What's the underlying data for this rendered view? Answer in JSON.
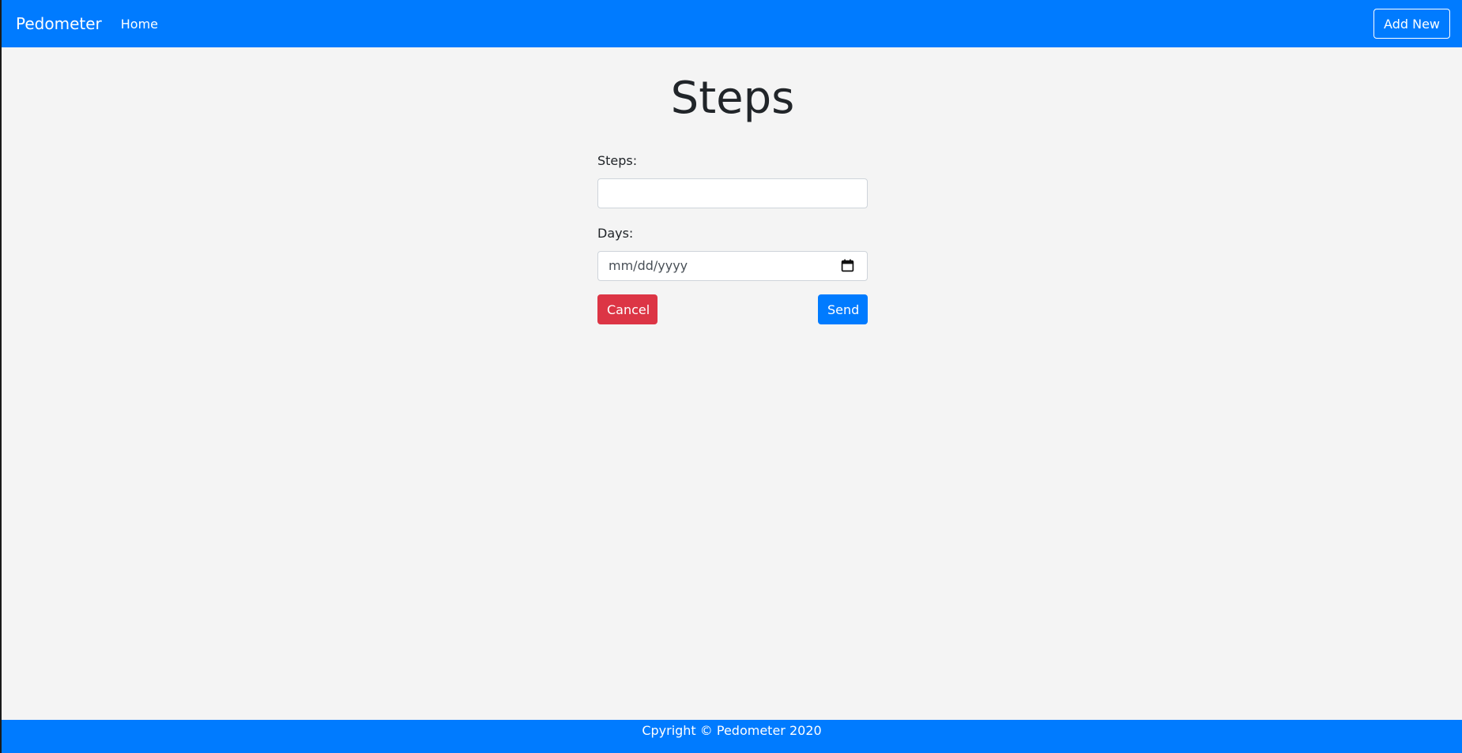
{
  "navbar": {
    "brand": "Pedometer",
    "home_link": "Home",
    "add_new_label": "Add New"
  },
  "page": {
    "title": "Steps"
  },
  "form": {
    "steps_label": "Steps:",
    "steps_value": "",
    "days_label": "Days:",
    "days_placeholder": "mm/dd/yyyy",
    "cancel_label": "Cancel",
    "send_label": "Send"
  },
  "footer": {
    "text": "Cpyright © Pedometer 2020"
  },
  "icons": {
    "date_picker": "calendar-icon"
  },
  "colors": {
    "primary": "#007bff",
    "danger": "#dc3545",
    "background": "#f4f4f4"
  }
}
